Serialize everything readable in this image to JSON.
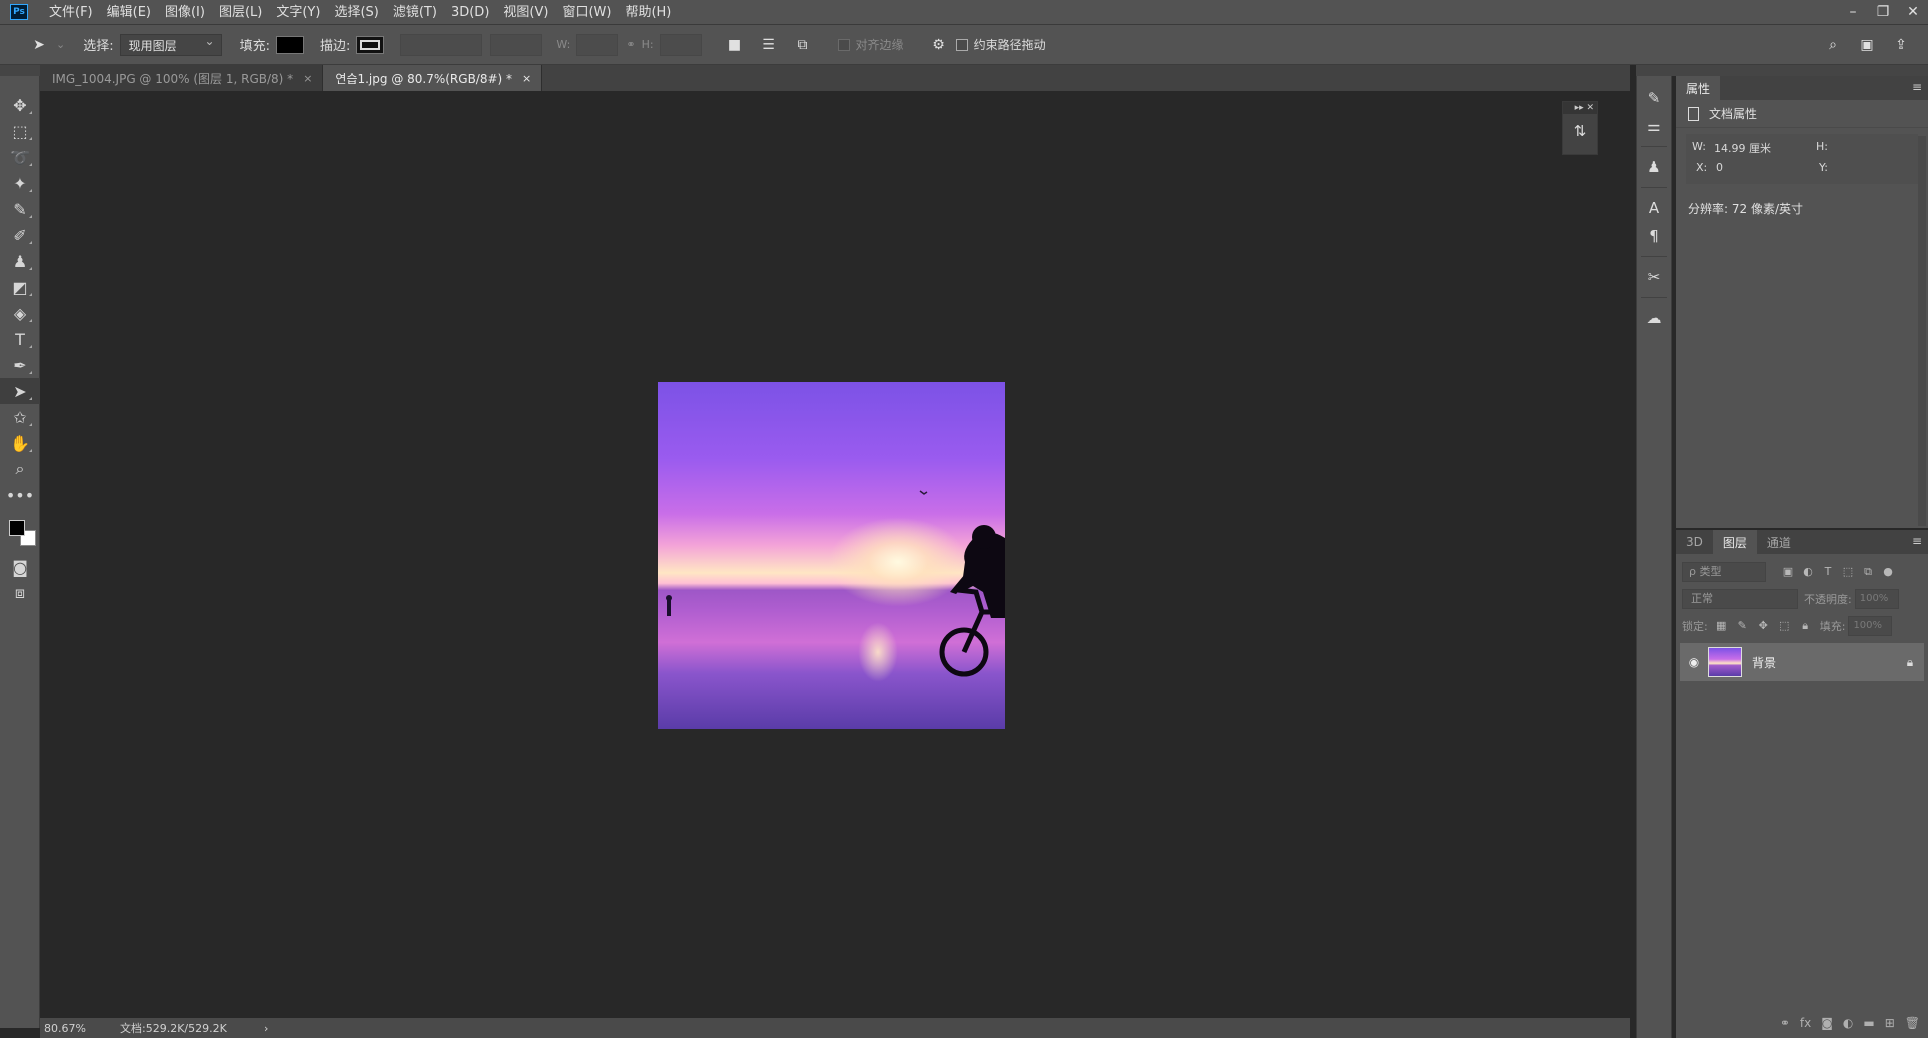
{
  "app": {
    "logo": "Ps"
  },
  "menu": [
    "文件(F)",
    "编辑(E)",
    "图像(I)",
    "图层(L)",
    "文字(Y)",
    "选择(S)",
    "滤镜(T)",
    "3D(D)",
    "视图(V)",
    "窗口(W)",
    "帮助(H)"
  ],
  "window_controls": {
    "minimize": "–",
    "restore": "❐",
    "close": "✕"
  },
  "options": {
    "select_label": "选择:",
    "select_value": "现用图层",
    "fill_label": "填充:",
    "stroke_label": "描边:",
    "w_label": "W:",
    "h_label": "H:",
    "align_edges_label": "对齐边缘",
    "constrain_path_label": "约束路径拖动"
  },
  "tabs": [
    {
      "label": "IMG_1004.JPG @ 100% (图层 1, RGB/8) *",
      "close": "×"
    },
    {
      "label": "연습1.jpg @ 80.7%(RGB/8#) *",
      "close": "×"
    }
  ],
  "canvas_widget": {
    "collapse": "▸▸ ✕"
  },
  "status": {
    "zoom": "80.67%",
    "doc": "文档:529.2K/529.2K",
    "arrow": "›"
  },
  "properties": {
    "tab": "属性",
    "section": "文档属性",
    "w_label": "W:",
    "w_value": "14.99 厘米",
    "h_label": "H:",
    "x_label": "X:",
    "x_value": "0",
    "y_label": "Y:",
    "resolution": "分辨率: 72 像素/英寸"
  },
  "layers_panel": {
    "tabs": [
      "3D",
      "图层",
      "通道"
    ],
    "filter_placeholder": "ρ 类型",
    "blend_mode": "正常",
    "opacity_label": "不透明度:",
    "opacity_value": "100%",
    "lock_label": "锁定:",
    "fill_label": "填充:",
    "fill_value": "100%",
    "layer_name": "背景"
  }
}
